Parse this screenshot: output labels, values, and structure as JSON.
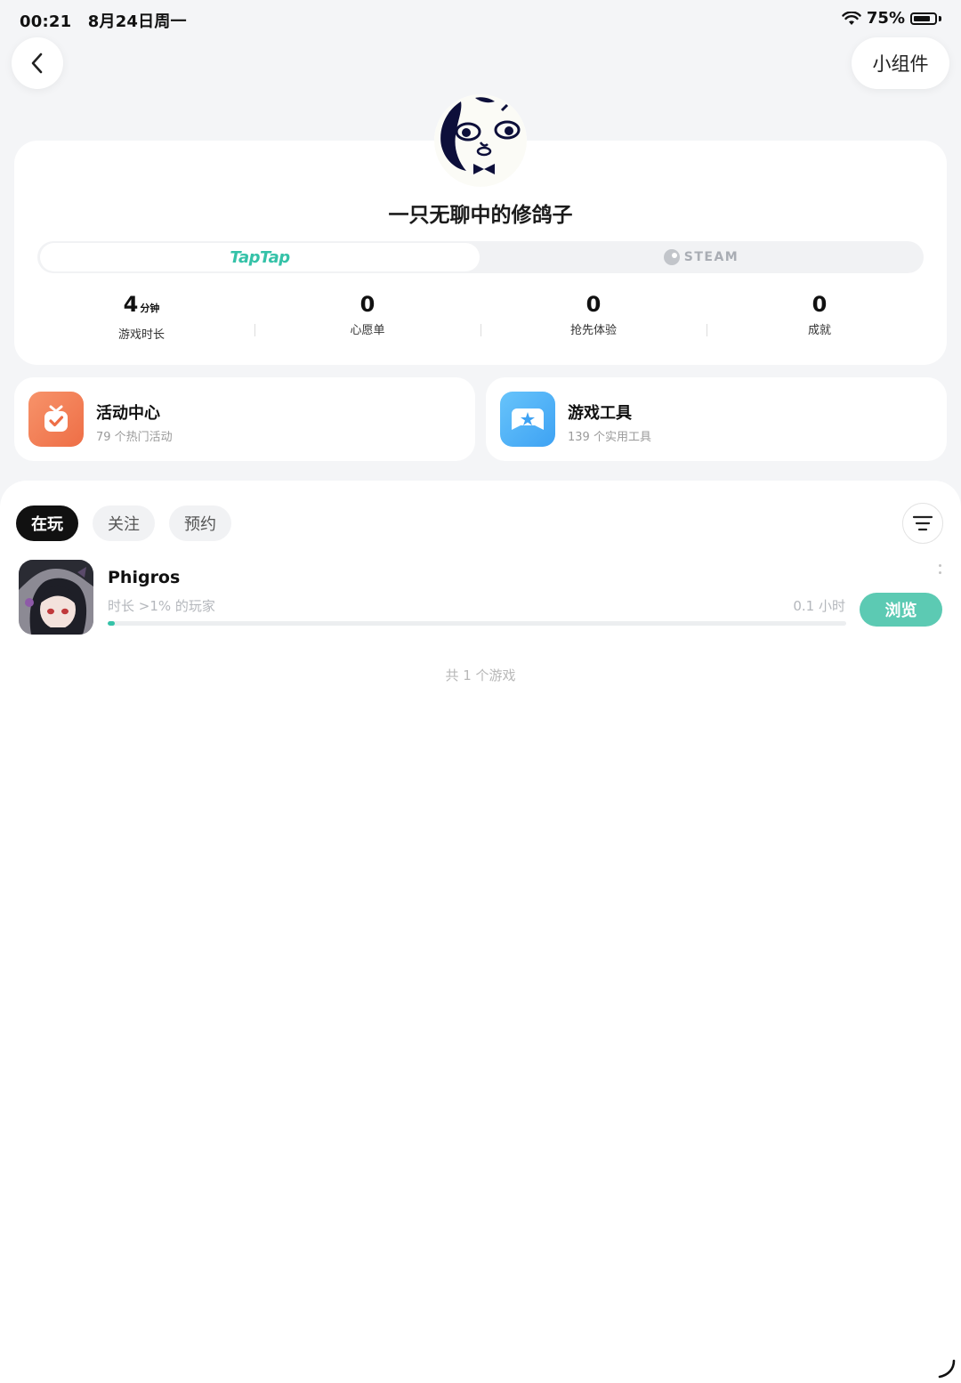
{
  "status_bar": {
    "time": "00:21",
    "date": "8月24日周一",
    "battery": "75%"
  },
  "header": {
    "widget_button": "小组件"
  },
  "profile": {
    "username": "一只无聊中的修鸽子",
    "platforms": [
      {
        "label": "TapTap",
        "active": true
      },
      {
        "label": "STEAM",
        "active": false
      }
    ],
    "stats": [
      {
        "value": "4",
        "unit": "分钟",
        "label": "游戏时长"
      },
      {
        "value": "0",
        "unit": "",
        "label": "心愿单"
      },
      {
        "value": "0",
        "unit": "",
        "label": "抢先体验"
      },
      {
        "value": "0",
        "unit": "",
        "label": "成就"
      }
    ]
  },
  "shortcuts": [
    {
      "title": "活动中心",
      "subtitle": "79 个热门活动",
      "icon": "gift-check-icon",
      "color": "#ee6e46"
    },
    {
      "title": "游戏工具",
      "subtitle": "139 个实用工具",
      "icon": "gamepad-icon",
      "color": "#3ea2f3"
    }
  ],
  "library": {
    "tabs": [
      {
        "label": "在玩",
        "active": true
      },
      {
        "label": "关注",
        "active": false
      },
      {
        "label": "预约",
        "active": false
      }
    ],
    "games": [
      {
        "name": "Phigros",
        "rank": "时长 >1% 的玩家",
        "hours": "0.1 小时",
        "progress": 0.01,
        "action": "浏览"
      }
    ],
    "count_text": "共 1 个游戏"
  },
  "colors": {
    "accent": "#35c2a8",
    "browse_button": "#5ccab3"
  }
}
